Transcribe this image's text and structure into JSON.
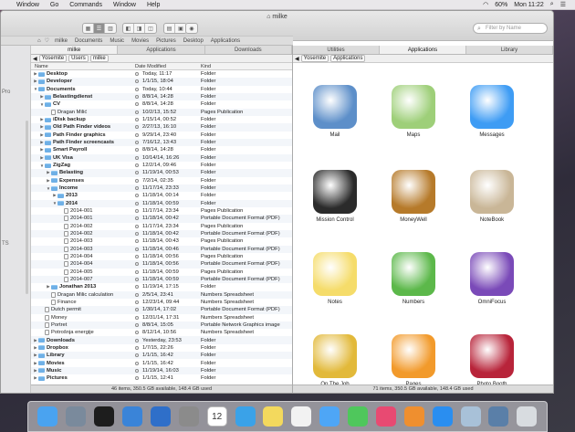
{
  "menubar": {
    "items": [
      "Window",
      "Go",
      "Commands",
      "Window",
      "Help"
    ],
    "battery": "60%",
    "clock": "Mon 11:22"
  },
  "window": {
    "title": "milke",
    "search_placeholder": "Filter by Name",
    "favorites": [
      "milke",
      "Documents",
      "Music",
      "Movies",
      "Pictures",
      "Desktop",
      "Applications"
    ],
    "sidebar_labels": [
      "Pro",
      "TS"
    ]
  },
  "left_pane": {
    "tabs": [
      "milke",
      "Applications",
      "Downloads"
    ],
    "path": [
      "Yosemite",
      "Users",
      "milke"
    ],
    "columns": {
      "name": "Name",
      "date": "Date Modified",
      "kind": "Kind"
    },
    "rows": [
      {
        "d": 0,
        "t": "f",
        "e": "c",
        "n": "Desktop",
        "dt": "Today, 11:17",
        "k": "Folder"
      },
      {
        "d": 0,
        "t": "f",
        "e": "c",
        "n": "Developer",
        "dt": "1/1/15, 18:04",
        "k": "Folder"
      },
      {
        "d": 0,
        "t": "f",
        "e": "o",
        "n": "Documents",
        "dt": "Today, 10:44",
        "k": "Folder"
      },
      {
        "d": 1,
        "t": "f",
        "e": "c",
        "n": "Belastingdienst",
        "dt": "8/8/14, 14:28",
        "k": "Folder"
      },
      {
        "d": 1,
        "t": "f",
        "e": "o",
        "n": "CV",
        "dt": "8/8/14, 14:28",
        "k": "Folder"
      },
      {
        "d": 2,
        "t": "d",
        "e": "",
        "n": "Dragan Milić",
        "dt": "10/2/13, 15:52",
        "k": "Pages Publication"
      },
      {
        "d": 1,
        "t": "f",
        "e": "c",
        "n": "iDisk backup",
        "dt": "1/15/14, 00:52",
        "k": "Folder"
      },
      {
        "d": 1,
        "t": "f",
        "e": "c",
        "n": "Old Path Finder videos",
        "dt": "2/27/13, 16:10",
        "k": "Folder"
      },
      {
        "d": 1,
        "t": "f",
        "e": "c",
        "n": "Path Finder graphics",
        "dt": "9/29/14, 23:40",
        "k": "Folder"
      },
      {
        "d": 1,
        "t": "f",
        "e": "c",
        "n": "Path Finder screencasts",
        "dt": "7/16/12, 13:43",
        "k": "Folder"
      },
      {
        "d": 1,
        "t": "f",
        "e": "c",
        "n": "Smart Payroll",
        "dt": "8/8/14, 14:28",
        "k": "Folder"
      },
      {
        "d": 1,
        "t": "f",
        "e": "c",
        "n": "UK Visa",
        "dt": "10/14/14, 16:26",
        "k": "Folder"
      },
      {
        "d": 1,
        "t": "f",
        "e": "o",
        "n": "ZigZag",
        "dt": "12/2/14, 09:46",
        "k": "Folder"
      },
      {
        "d": 2,
        "t": "f",
        "e": "c",
        "n": "Belasting",
        "dt": "11/19/14, 00:53",
        "k": "Folder"
      },
      {
        "d": 2,
        "t": "f",
        "e": "c",
        "n": "Expenses",
        "dt": "7/2/14, 02:35",
        "k": "Folder"
      },
      {
        "d": 2,
        "t": "f",
        "e": "o",
        "n": "Income",
        "dt": "11/17/14, 23:33",
        "k": "Folder"
      },
      {
        "d": 3,
        "t": "f",
        "e": "c",
        "n": "2013",
        "dt": "11/18/14, 00:14",
        "k": "Folder"
      },
      {
        "d": 3,
        "t": "f",
        "e": "o",
        "n": "2014",
        "dt": "11/18/14, 00:59",
        "k": "Folder"
      },
      {
        "d": 4,
        "t": "d",
        "e": "",
        "n": "2014-001",
        "dt": "11/17/14, 23:34",
        "k": "Pages Publication"
      },
      {
        "d": 4,
        "t": "d",
        "e": "",
        "n": "2014-001",
        "dt": "11/18/14, 00:42",
        "k": "Portable Document Format (PDF)"
      },
      {
        "d": 4,
        "t": "d",
        "e": "",
        "n": "2014-002",
        "dt": "11/17/14, 23:34",
        "k": "Pages Publication"
      },
      {
        "d": 4,
        "t": "d",
        "e": "",
        "n": "2014-002",
        "dt": "11/18/14, 00:42",
        "k": "Portable Document Format (PDF)"
      },
      {
        "d": 4,
        "t": "d",
        "e": "",
        "n": "2014-003",
        "dt": "11/18/14, 00:43",
        "k": "Pages Publication"
      },
      {
        "d": 4,
        "t": "d",
        "e": "",
        "n": "2014-003",
        "dt": "11/18/14, 00:46",
        "k": "Portable Document Format (PDF)"
      },
      {
        "d": 4,
        "t": "d",
        "e": "",
        "n": "2014-004",
        "dt": "11/18/14, 00:56",
        "k": "Pages Publication"
      },
      {
        "d": 4,
        "t": "d",
        "e": "",
        "n": "2014-004",
        "dt": "11/18/14, 00:56",
        "k": "Portable Document Format (PDF)"
      },
      {
        "d": 4,
        "t": "d",
        "e": "",
        "n": "2014-005",
        "dt": "11/18/14, 00:59",
        "k": "Pages Publication"
      },
      {
        "d": 4,
        "t": "d",
        "e": "",
        "n": "2014-007",
        "dt": "11/18/14, 00:59",
        "k": "Portable Document Format (PDF)"
      },
      {
        "d": 2,
        "t": "f",
        "e": "c",
        "n": "Jonathan 2013",
        "dt": "11/19/14, 17:15",
        "k": "Folder"
      },
      {
        "d": 2,
        "t": "d",
        "e": "",
        "n": "Dragan Milic calculation",
        "dt": "2/5/14, 23:41",
        "k": "Numbers Spreadsheet"
      },
      {
        "d": 2,
        "t": "d",
        "e": "",
        "n": "Finance",
        "dt": "12/23/14, 09:44",
        "k": "Numbers Spreadsheet"
      },
      {
        "d": 1,
        "t": "d",
        "e": "",
        "n": "Dutch permit",
        "dt": "1/30/14, 17:02",
        "k": "Portable Document Format (PDF)"
      },
      {
        "d": 1,
        "t": "d",
        "e": "",
        "n": "Money",
        "dt": "12/31/14, 17:31",
        "k": "Numbers Spreadsheet"
      },
      {
        "d": 1,
        "t": "d",
        "e": "",
        "n": "Portret",
        "dt": "8/8/14, 15:05",
        "k": "Portable Network Graphics image"
      },
      {
        "d": 1,
        "t": "d",
        "e": "",
        "n": "Potrošnja energije",
        "dt": "8/12/14, 10:56",
        "k": "Numbers Spreadsheet"
      },
      {
        "d": 0,
        "t": "f",
        "e": "c",
        "n": "Downloads",
        "dt": "Yesterday, 23:53",
        "k": "Folder"
      },
      {
        "d": 0,
        "t": "f",
        "e": "c",
        "n": "Dropbox",
        "dt": "1/7/15, 22:26",
        "k": "Folder"
      },
      {
        "d": 0,
        "t": "f",
        "e": "c",
        "n": "Library",
        "dt": "1/1/15, 16:42",
        "k": "Folder"
      },
      {
        "d": 0,
        "t": "f",
        "e": "c",
        "n": "Movies",
        "dt": "1/1/15, 16:42",
        "k": "Folder"
      },
      {
        "d": 0,
        "t": "f",
        "e": "c",
        "n": "Music",
        "dt": "11/19/14, 16:03",
        "k": "Folder"
      },
      {
        "d": 0,
        "t": "f",
        "e": "c",
        "n": "Pictures",
        "dt": "1/1/15, 12:41",
        "k": "Folder"
      }
    ],
    "status": "46 items, 350.5 GB available, 148.4 GB used"
  },
  "right_pane": {
    "tabs": [
      "Utilities",
      "Applications",
      "Library"
    ],
    "path": [
      "Yosemite",
      "Applications"
    ],
    "apps": [
      {
        "label": "Mail",
        "color": "#5d8fc9"
      },
      {
        "label": "Maps",
        "color": "#9ecf79"
      },
      {
        "label": "Messages",
        "color": "#3e9cf4"
      },
      {
        "label": "Mission Control",
        "color": "#2b2b2b"
      },
      {
        "label": "MoneyWell",
        "color": "#b67a2a"
      },
      {
        "label": "NoteBook",
        "color": "#c9b697"
      },
      {
        "label": "Notes",
        "color": "#f5dc6a"
      },
      {
        "label": "Numbers",
        "color": "#5cb84a"
      },
      {
        "label": "OmniFocus",
        "color": "#7a4ab8"
      },
      {
        "label": "On The Job",
        "color": "#e2b93a"
      },
      {
        "label": "Pages",
        "color": "#f29a2b"
      },
      {
        "label": "Photo Booth",
        "color": "#b8243a"
      }
    ],
    "status": "71 items, 350.5 GB available, 148.4 GB used"
  },
  "dock": {
    "calendar_day": "12",
    "icons": [
      {
        "name": "finder",
        "color": "#4aa3f0"
      },
      {
        "name": "launchpad",
        "color": "#7a8a9c"
      },
      {
        "name": "terminal",
        "color": "#1d1d1d"
      },
      {
        "name": "xcode",
        "color": "#3a84d8"
      },
      {
        "name": "pathfinder",
        "color": "#2f6fc9"
      },
      {
        "name": "settings",
        "color": "#8b8b8b"
      },
      {
        "name": "calendar",
        "color": "#ffffff"
      },
      {
        "name": "safari",
        "color": "#3aa2e8"
      },
      {
        "name": "notes",
        "color": "#f3d95d"
      },
      {
        "name": "reminders",
        "color": "#f2f2f2"
      },
      {
        "name": "messages",
        "color": "#4ea6f6"
      },
      {
        "name": "facetime",
        "color": "#4fc75c"
      },
      {
        "name": "itunes",
        "color": "#e84a72"
      },
      {
        "name": "ibooks",
        "color": "#ef8f2f"
      },
      {
        "name": "appstore",
        "color": "#2a8ef0"
      },
      {
        "name": "preview",
        "color": "#a8c1d8"
      },
      {
        "name": "photo",
        "color": "#5a7fa8"
      },
      {
        "name": "trash",
        "color": "#d8dce0"
      }
    ]
  }
}
